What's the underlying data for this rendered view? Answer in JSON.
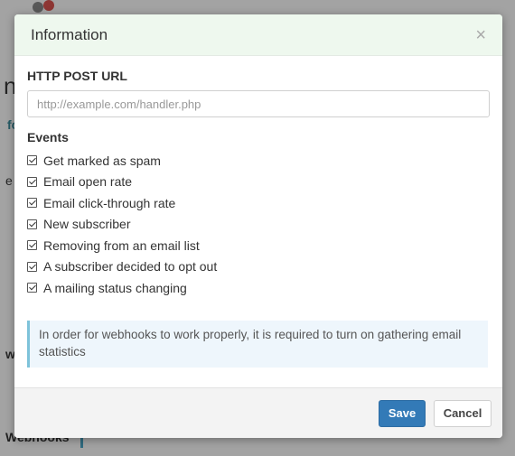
{
  "background": {
    "frag_n": "n",
    "frag_fc": "fc",
    "frag_e": "e",
    "frag_w": "w",
    "frag_webhooks": "Webhooks"
  },
  "modal": {
    "title": "Information",
    "close_glyph": "×",
    "url_label": "HTTP POST URL",
    "url_value": "",
    "url_placeholder": "http://example.com/handler.php",
    "events_label": "Events",
    "events": [
      {
        "label": "Get marked as spam",
        "checked": true
      },
      {
        "label": "Email open rate",
        "checked": true
      },
      {
        "label": "Email click-through rate",
        "checked": true
      },
      {
        "label": "New subscriber",
        "checked": true
      },
      {
        "label": "Removing from an email list",
        "checked": true
      },
      {
        "label": "A subscriber decided to opt out",
        "checked": true
      },
      {
        "label": "A mailing status changing",
        "checked": true
      }
    ],
    "notice": "In order for webhooks to work properly, it is required to turn on gathering email statistics",
    "save_label": "Save",
    "cancel_label": "Cancel"
  },
  "colors": {
    "header_bg": "#eef8ee",
    "primary": "#337ab7",
    "notice_bg": "#eef6fc",
    "notice_border": "#7ec3da"
  }
}
